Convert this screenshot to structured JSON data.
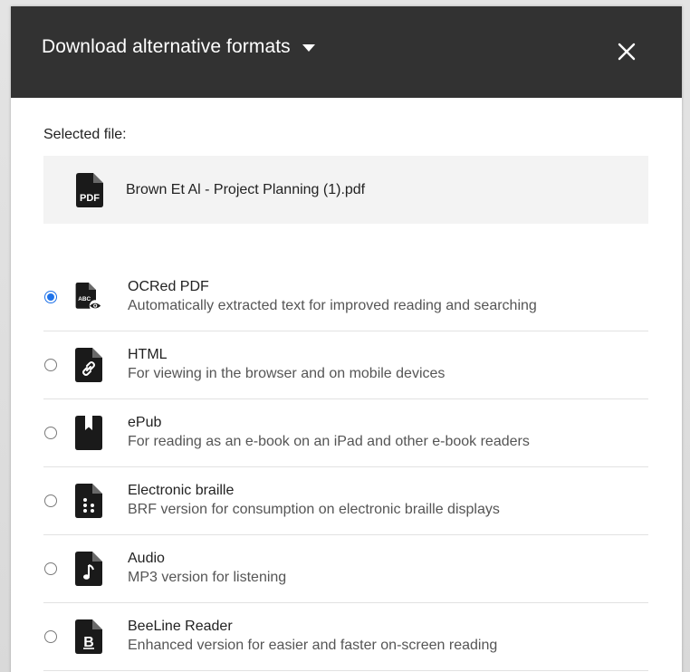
{
  "dialog": {
    "title": "Download alternative formats",
    "close_icon": "close-icon",
    "caret_icon": "caret-down-icon"
  },
  "selected": {
    "label": "Selected file:",
    "file_name": "Brown Et Al - Project Planning (1).pdf",
    "file_icon": "pdf-file-icon",
    "file_icon_text": "PDF"
  },
  "options": [
    {
      "title": "OCRed PDF",
      "description": "Automatically extracted text for improved reading and searching",
      "icon": "ocr-pdf-icon",
      "icon_text": "ABC",
      "checked": true
    },
    {
      "title": "HTML",
      "description": "For viewing in the browser and on mobile devices",
      "icon": "html-link-icon",
      "checked": false
    },
    {
      "title": "ePub",
      "description": "For reading as an e-book on an iPad and other e-book readers",
      "icon": "epub-bookmark-icon",
      "checked": false
    },
    {
      "title": "Electronic braille",
      "description": "BRF version for consumption on electronic braille displays",
      "icon": "braille-icon",
      "checked": false
    },
    {
      "title": "Audio",
      "description": "MP3 version for listening",
      "icon": "audio-note-icon",
      "checked": false
    },
    {
      "title": "BeeLine Reader",
      "description": "Enhanced version for easier and faster on-screen reading",
      "icon": "beeline-b-icon",
      "icon_text": "B",
      "checked": false
    }
  ],
  "colors": {
    "header_bg": "#323232",
    "accent": "#1f73ea",
    "file_box_bg": "#f3f3f3"
  }
}
